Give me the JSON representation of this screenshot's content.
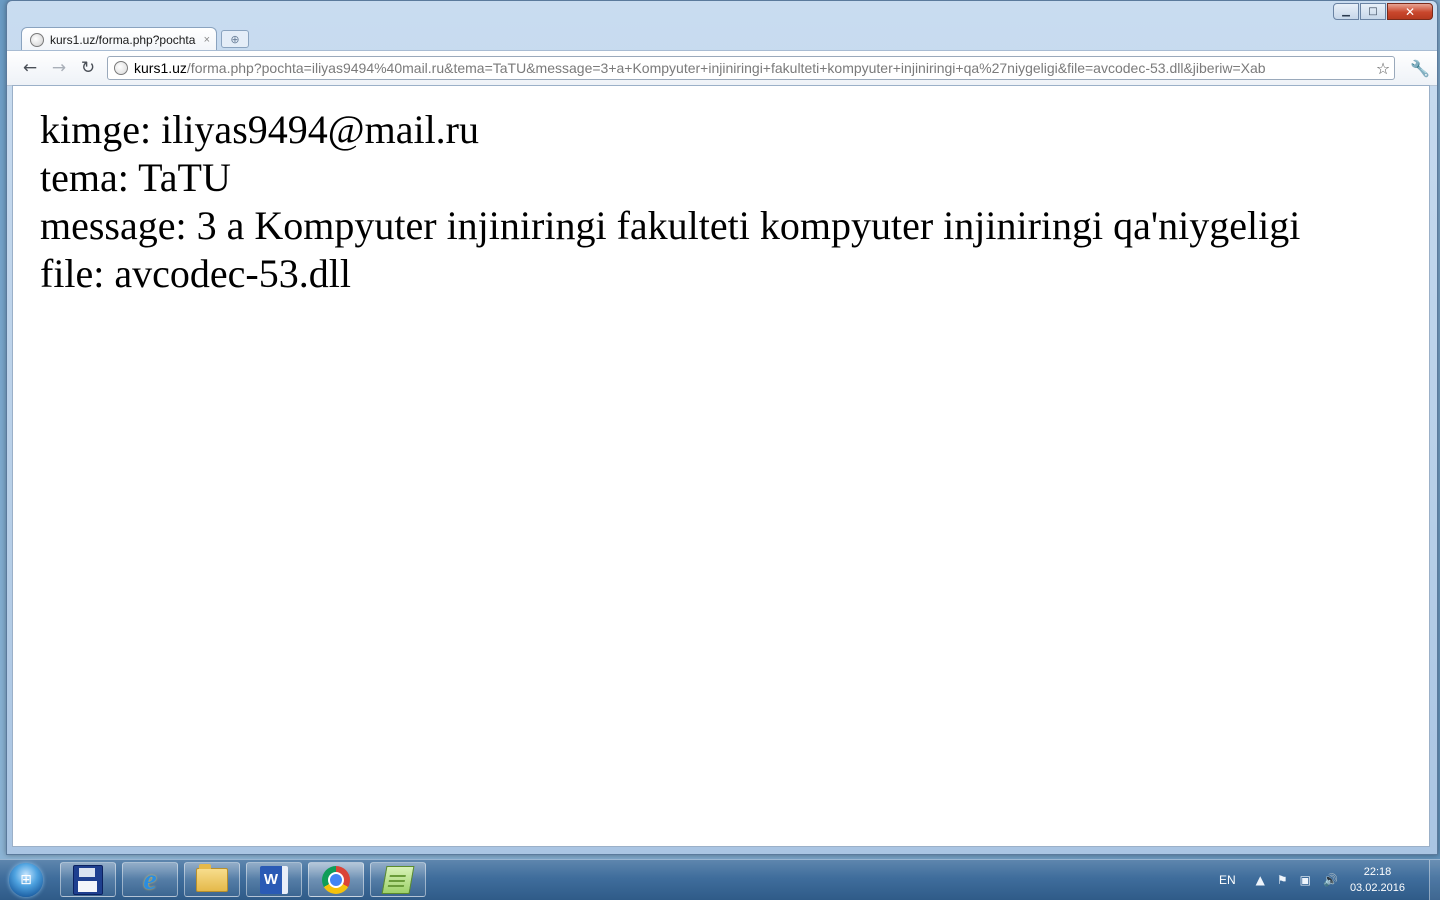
{
  "window": {
    "controls": {
      "minimize": "▁",
      "maximize": "□",
      "close": "✕"
    }
  },
  "tabs": [
    {
      "title": "kurs1.uz/forma.php?pochta",
      "close": "×"
    }
  ],
  "toolbar": {
    "back_icon": "←",
    "forward_icon": "→",
    "reload_icon": "↻",
    "star_icon": "☆",
    "wrench_icon": "🔧",
    "newtab_icon": "⊕"
  },
  "address_bar": {
    "host": "kurs1.uz",
    "rest": "/forma.php?pochta=iliyas9494%40mail.ru&tema=TaTU&message=3+a+Kompyuter+injiniringi+fakulteti+kompyuter+injiniringi+qa%27niygeligi&file=avcodec-53.dll&jiberiw=Xab"
  },
  "page": {
    "lines": [
      "kimge: iliyas9494@mail.ru",
      "tema: TaTU",
      "message: 3 a Kompyuter injiniringi fakulteti kompyuter injiniringi qa'niygeligi",
      "file: avcodec-53.dll"
    ]
  },
  "taskbar": {
    "start_icon": "⊞",
    "apps": [
      {
        "name": "save-app",
        "icon": "floppy-icon"
      },
      {
        "name": "internet-explorer",
        "icon": "ie-icon"
      },
      {
        "name": "file-explorer",
        "icon": "folder-icon"
      },
      {
        "name": "word",
        "icon": "word-icon",
        "glyph": "W"
      },
      {
        "name": "chrome",
        "icon": "chrome-icon"
      },
      {
        "name": "notepad",
        "icon": "notepad-icon"
      }
    ],
    "tray": {
      "language": "EN",
      "show_hidden_icon": "▲",
      "flag_icon": "⚑",
      "network_icon": "▣",
      "volume_icon": "🔊",
      "time": "22:18",
      "date": "03.02.2016"
    }
  }
}
